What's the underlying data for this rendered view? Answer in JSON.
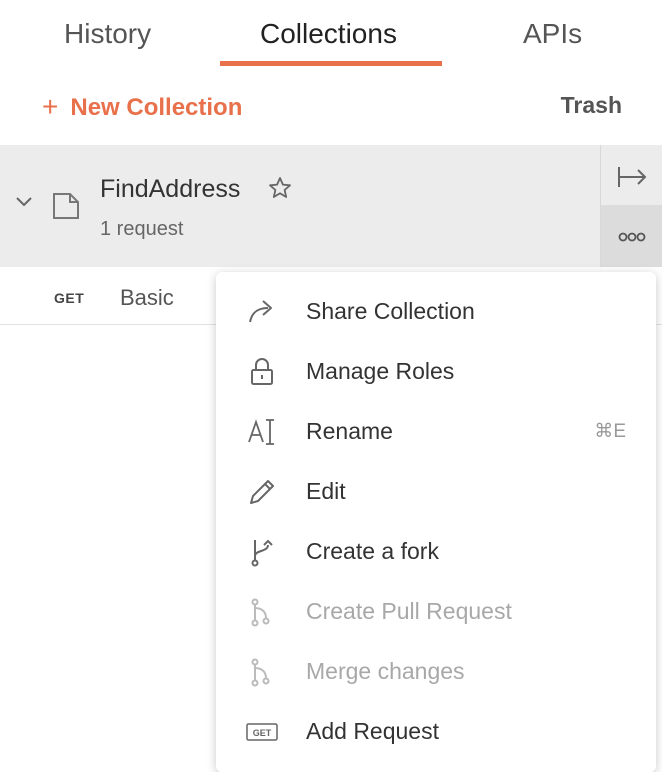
{
  "tabs": {
    "history": "History",
    "collections": "Collections",
    "apis": "APIs"
  },
  "toolbar": {
    "new_collection_plus": "+",
    "new_collection": "New Collection",
    "trash": "Trash"
  },
  "collection": {
    "name": "FindAddress",
    "count": "1 request"
  },
  "request": {
    "method": "GET",
    "name": "Basic"
  },
  "menu": {
    "share": "Share Collection",
    "roles": "Manage Roles",
    "rename": "Rename",
    "rename_shortcut": "⌘E",
    "edit": "Edit",
    "fork": "Create a fork",
    "pull": "Create Pull Request",
    "merge": "Merge changes",
    "add_request": "Add Request",
    "add_request_icon_text": "GET"
  },
  "colors": {
    "accent": "#e8704a",
    "row_bg": "#ececec",
    "disabled_text": "#a8a8a8"
  },
  "icons": [
    "chevron-down-icon",
    "collection-folder-icon",
    "star-icon",
    "expand-panel-icon",
    "more-options-icon",
    "share-icon",
    "lock-icon",
    "rename-icon",
    "pencil-icon",
    "fork-icon",
    "pull-request-icon",
    "merge-icon",
    "get-request-icon"
  ]
}
